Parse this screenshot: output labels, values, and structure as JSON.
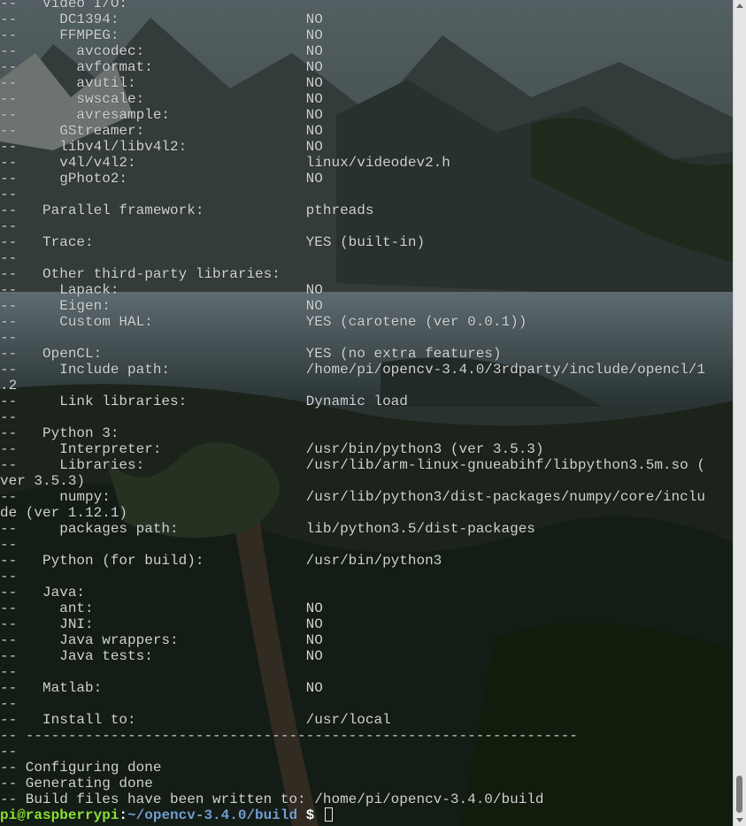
{
  "terminal": {
    "lines": [
      "--   Video I/O:",
      "--     DC1394:                      NO",
      "--     FFMPEG:                      NO",
      "--       avcodec:                   NO",
      "--       avformat:                  NO",
      "--       avutil:                    NO",
      "--       swscale:                   NO",
      "--       avresample:                NO",
      "--     GStreamer:                   NO",
      "--     libv4l/libv4l2:              NO",
      "--     v4l/v4l2:                    linux/videodev2.h",
      "--     gPhoto2:                     NO",
      "--",
      "--   Parallel framework:            pthreads",
      "--",
      "--   Trace:                         YES (built-in)",
      "--",
      "--   Other third-party libraries:",
      "--     Lapack:                      NO",
      "--     Eigen:                       NO",
      "--     Custom HAL:                  YES (carotene (ver 0.0.1))",
      "--",
      "--   OpenCL:                        YES (no extra features)",
      "--     Include path:                /home/pi/opencv-3.4.0/3rdparty/include/opencl/1",
      ".2",
      "--     Link libraries:              Dynamic load",
      "--",
      "--   Python 3:",
      "--     Interpreter:                 /usr/bin/python3 (ver 3.5.3)",
      "--     Libraries:                   /usr/lib/arm-linux-gnueabihf/libpython3.5m.so (",
      "ver 3.5.3)",
      "--     numpy:                       /usr/lib/python3/dist-packages/numpy/core/inclu",
      "de (ver 1.12.1)",
      "--     packages path:               lib/python3.5/dist-packages",
      "--",
      "--   Python (for build):            /usr/bin/python3",
      "--",
      "--   Java:",
      "--     ant:                         NO",
      "--     JNI:                         NO",
      "--     Java wrappers:               NO",
      "--     Java tests:                  NO",
      "--",
      "--   Matlab:                        NO",
      "--",
      "--   Install to:                    /usr/local",
      "-- -----------------------------------------------------------------",
      "--",
      "-- Configuring done",
      "-- Generating done",
      "-- Build files have been written to: /home/pi/opencv-3.4.0/build"
    ],
    "prompt": {
      "user_host": "pi@raspberrypi",
      "colon": ":",
      "path": "~/opencv-3.4.0/build",
      "symbol": " $ "
    }
  },
  "colors": {
    "text": "#d2d2d2",
    "prompt_user": "#8ae234",
    "prompt_path": "#729fcf",
    "scrollbar_track": "#e6e6e6",
    "scrollbar_thumb": "#7b7b7b"
  },
  "icons": {
    "scroll_up": "triangle-up",
    "scroll_down": "triangle-down"
  }
}
